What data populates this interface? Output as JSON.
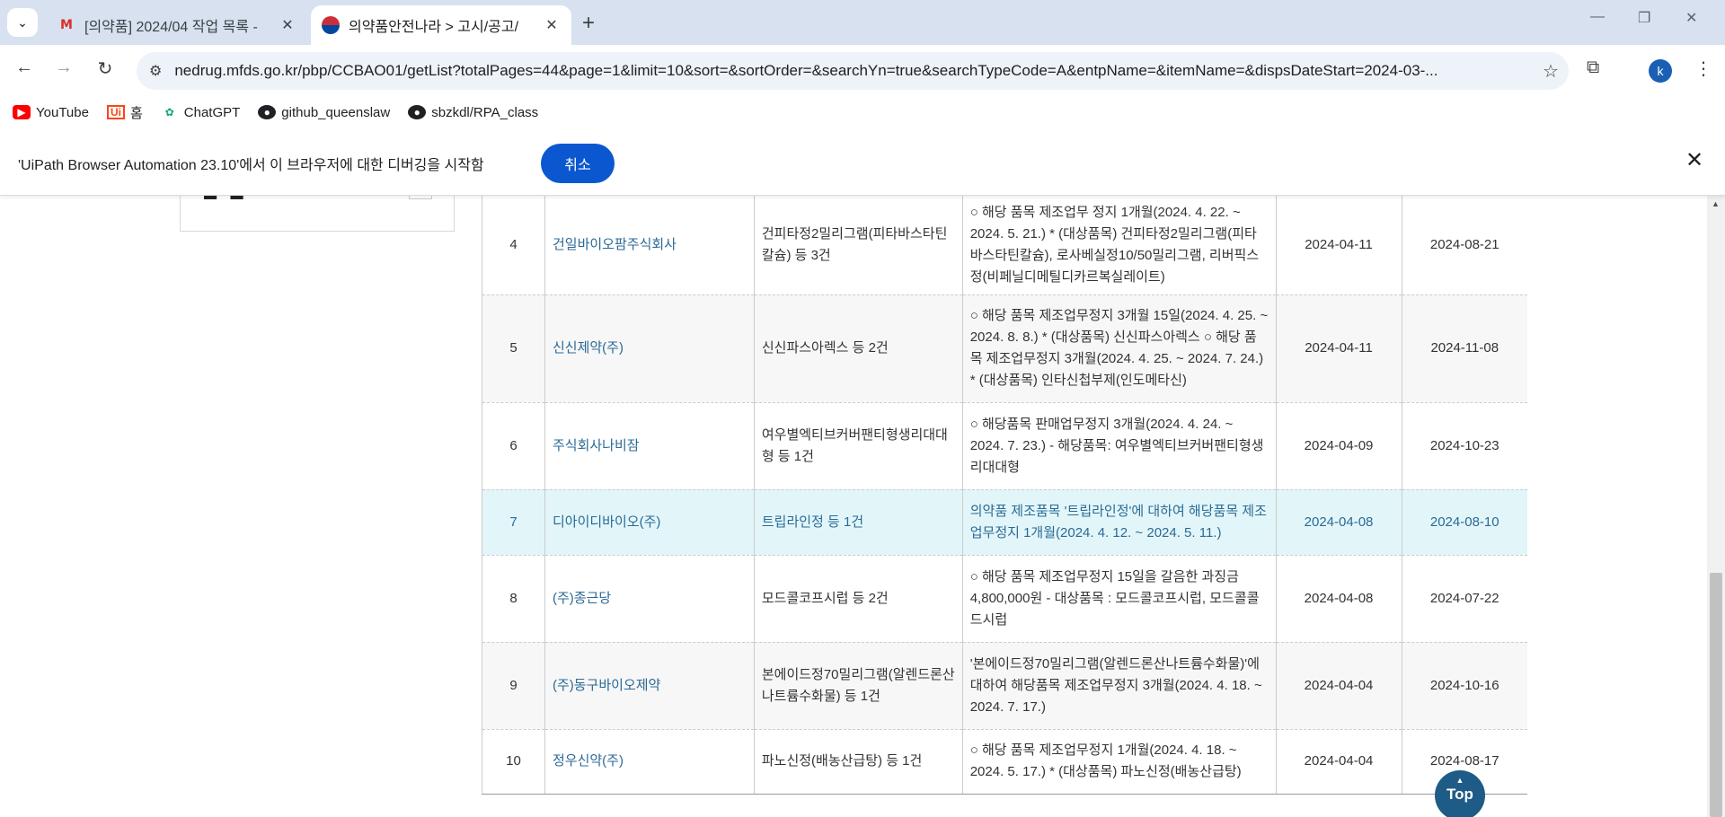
{
  "tabs": [
    {
      "title": "[의약품] 2024/04 작업 목록 - ",
      "favicon": "gmail-icon",
      "active": false
    },
    {
      "title": "의약품안전나라 > 고시/공고/",
      "favicon": "korea-flag-icon",
      "active": true
    }
  ],
  "address": {
    "url": "nedrug.mfds.go.kr/pbp/CCBAO01/getList?totalPages=44&page=1&limit=10&sort=&sortOrder=&searchYn=true&searchTypeCode=A&entpName=&itemName=&dispsDateStart=2024-03-..."
  },
  "profile": {
    "initial": "k"
  },
  "bookmarks": [
    {
      "label": "YouTube",
      "icon": "youtube-icon"
    },
    {
      "label": "홈",
      "icon": "uipath-icon",
      "icon_text": "Ui"
    },
    {
      "label": "ChatGPT",
      "icon": "chatgpt-icon"
    },
    {
      "label": "github_queenslaw",
      "icon": "github-icon"
    },
    {
      "label": "sbzkdl/RPA_class",
      "icon": "github-icon"
    }
  ],
  "infobar": {
    "message": "'UiPath Browser Automation 23.10'에서 이 브라우저에 대한 디버깅을 시작함",
    "cancel_label": "취소"
  },
  "table": {
    "rows": [
      {
        "no": "4",
        "company": "건일바이오팜주식회사",
        "item": "건피타정2밀리그램(피타바스타틴칼슘) 등 3건",
        "desc": "○ 해당 품목 제조업무 정지 1개월(2024. 4. 22. ~ 2024. 5. 21.) * (대상품목) 건피타정2밀리그램(피타바스타틴칼슘), 로사베실정10/50밀리그램, 리버픽스정(비페닐디메틸디카르복실레이트)",
        "date1": "2024-04-11",
        "date2": "2024-08-21"
      },
      {
        "no": "5",
        "company": "신신제약(주)",
        "item": "신신파스아렉스 등 2건",
        "desc": "○ 해당 품목 제조업무정지 3개월 15일(2024. 4. 25. ~ 2024. 8. 8.) * (대상품목) 신신파스아렉스 ○ 해당 품목 제조업무정지 3개월(2024. 4. 25. ~ 2024. 7. 24.) * (대상품목) 인타신첩부제(인도메타신)",
        "date1": "2024-04-11",
        "date2": "2024-11-08"
      },
      {
        "no": "6",
        "company": "주식회사나비잠",
        "item": "여우별엑티브커버팬티형생리대대형 등 1건",
        "desc": "○ 해당품목 판매업무정지 3개월(2024. 4. 24. ~ 2024. 7. 23.) - 해당품목: 여우별엑티브커버팬티형생리대대형",
        "date1": "2024-04-09",
        "date2": "2024-10-23"
      },
      {
        "no": "7",
        "company": "디아이디바이오(주)",
        "item": "트립라인정 등 1건",
        "desc": "의약품 제조품목 '트립라인정'에 대하여 해당품목 제조업무정지 1개월(2024. 4. 12. ~ 2024. 5. 11.)",
        "date1": "2024-04-08",
        "date2": "2024-08-10"
      },
      {
        "no": "8",
        "company": "(주)종근당",
        "item": "모드콜코프시럽 등 2건",
        "desc": "○ 해당 품목 제조업무정지 15일을 갈음한 과징금 4,800,000원 - 대상품목 : 모드콜코프시럽, 모드콜콜드시럽",
        "date1": "2024-04-08",
        "date2": "2024-07-22"
      },
      {
        "no": "9",
        "company": "(주)동구바이오제약",
        "item": "본에이드정70밀리그램(알렌드론산나트륨수화물) 등 1건",
        "desc": "'본에이드정70밀리그램(알렌드론산나트륨수화물)'에 대하여 해당품목 제조업무정지 3개월(2024. 4. 18. ~ 2024. 7. 17.)",
        "date1": "2024-04-04",
        "date2": "2024-10-16"
      },
      {
        "no": "10",
        "company": "정우신약(주)",
        "item": "파노신정(배농산급탕) 등 1건",
        "desc": "○ 해당 품목 제조업무정지 1개월(2024. 4. 18. ~ 2024. 5. 17.) * (대상품목) 파노신정(배농산급탕)",
        "date1": "2024-04-04",
        "date2": "2024-08-17"
      }
    ]
  },
  "top_button": {
    "label": "Top"
  },
  "colors": {
    "link": "#2b6a95",
    "highlight_row": "#e2f6f9",
    "accent": "#0b57d0",
    "top_button": "#1e5b86"
  }
}
